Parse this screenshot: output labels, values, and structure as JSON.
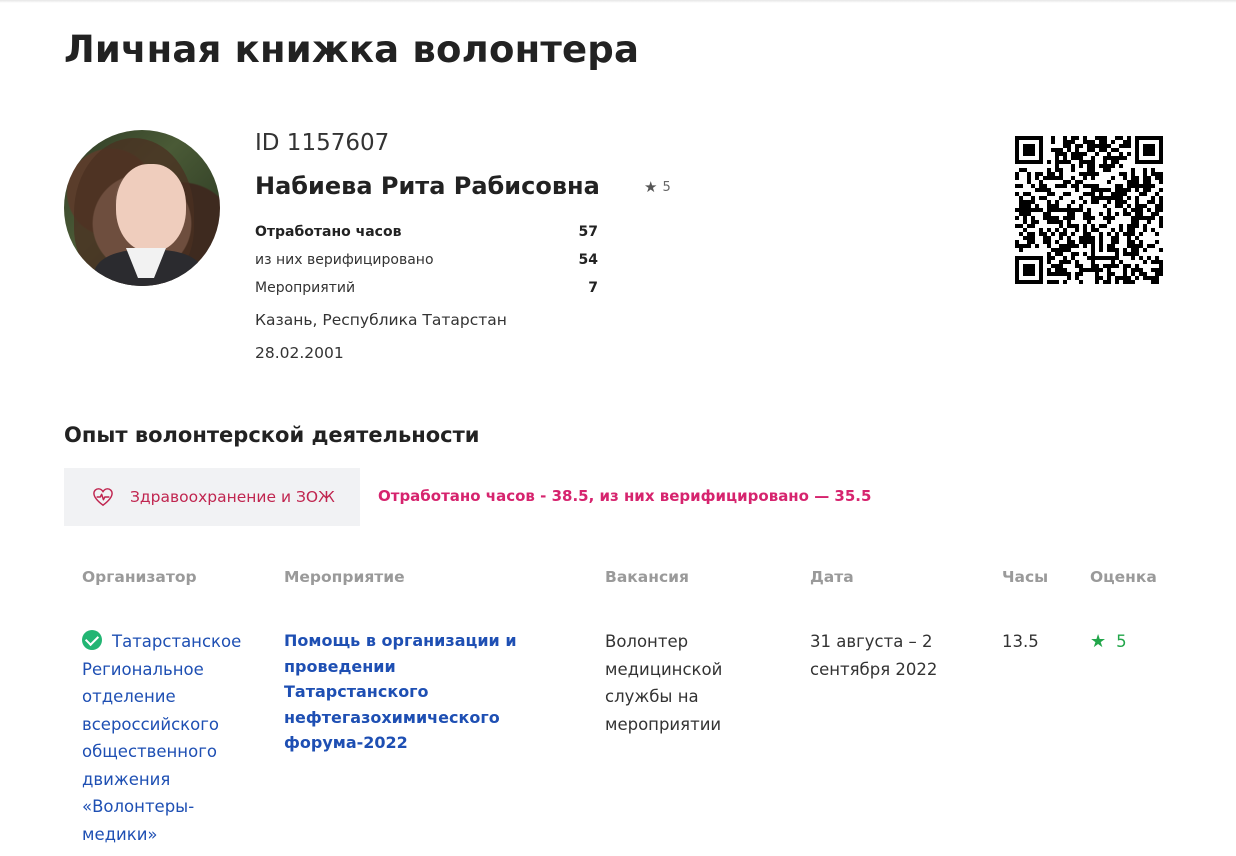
{
  "page": {
    "title": "Личная книжка волонтера"
  },
  "profile": {
    "id": "ID 1157607",
    "name": "Набиева Рита Рабисовна",
    "rating": "5",
    "stats": [
      {
        "label": "Отработано часов",
        "value": "57"
      },
      {
        "label": "из них верифицировано",
        "value": "54"
      },
      {
        "label": "Мероприятий",
        "value": "7"
      }
    ],
    "city": "Казань, Республика Татарстан",
    "birthdate": "28.02.2001",
    "rating_icon": "star-icon",
    "qr_icon": "qr-code"
  },
  "experience": {
    "section_title": "Опыт волонтерской деятельности",
    "category": {
      "icon": "heart-pulse-icon",
      "label": "Здравоохранение и ЗОЖ",
      "summary": "Отработано часов - 38.5, из них верифицировано — 35.5"
    },
    "table": {
      "headers": [
        "Организатор",
        "Мероприятие",
        "Вакансия",
        "Дата",
        "Часы",
        "Оценка"
      ],
      "rows": [
        {
          "organizer": "Татарстанское Региональное отделение всероссийского общественного движения «Волонтеры-медики»",
          "event": "Помощь в организации и проведении Татарстанского нефтегазохимического форума-2022",
          "vacancy": "Волонтер медицинской службы на мероприятии",
          "date": "31 августа – 2 сентября 2022",
          "hours": "13.5",
          "score": "5"
        }
      ]
    }
  },
  "colors": {
    "category_text": "#c0254f",
    "summary_text": "#d6246e",
    "link_blue": "#1e4fb3",
    "verified_green": "#22b573",
    "score_green": "#22a64a"
  }
}
